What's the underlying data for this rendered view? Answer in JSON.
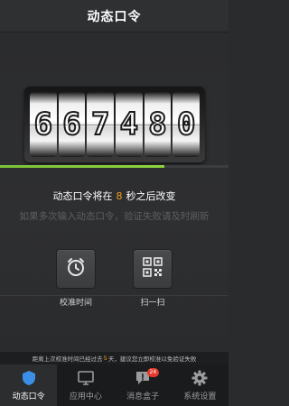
{
  "header": {
    "title": "动态口令"
  },
  "token": {
    "digits": [
      "6",
      "6",
      "7",
      "4",
      "8",
      "0"
    ],
    "progress_fraction": 0.72
  },
  "countdown": {
    "prefix": "动态口令将在",
    "seconds": "8",
    "suffix": "秒之后改变"
  },
  "hint": "如果多次输入动态口令，验证失败请及时刷新",
  "actions": [
    {
      "label": "校准时间",
      "icon": "alarm-clock-icon"
    },
    {
      "label": "扫一扫",
      "icon": "qr-code-icon"
    }
  ],
  "notice": {
    "prefix": "距离上次校准时间已经过去",
    "days": "5",
    "suffix": "天，建议您立即校准以免验证失败"
  },
  "tabs": [
    {
      "label": "动态口令",
      "icon": "shield-icon",
      "active": true
    },
    {
      "label": "应用中心",
      "icon": "monitor-icon"
    },
    {
      "label": "消息盒子",
      "icon": "message-icon",
      "badge": "24"
    },
    {
      "label": "系统设置",
      "icon": "gear-icon"
    }
  ],
  "colors": {
    "accent_orange": "#f39b1a",
    "progress_green": "#8ed33f",
    "badge_red": "#e23a2e",
    "active_blue": "#3b8fe6"
  }
}
